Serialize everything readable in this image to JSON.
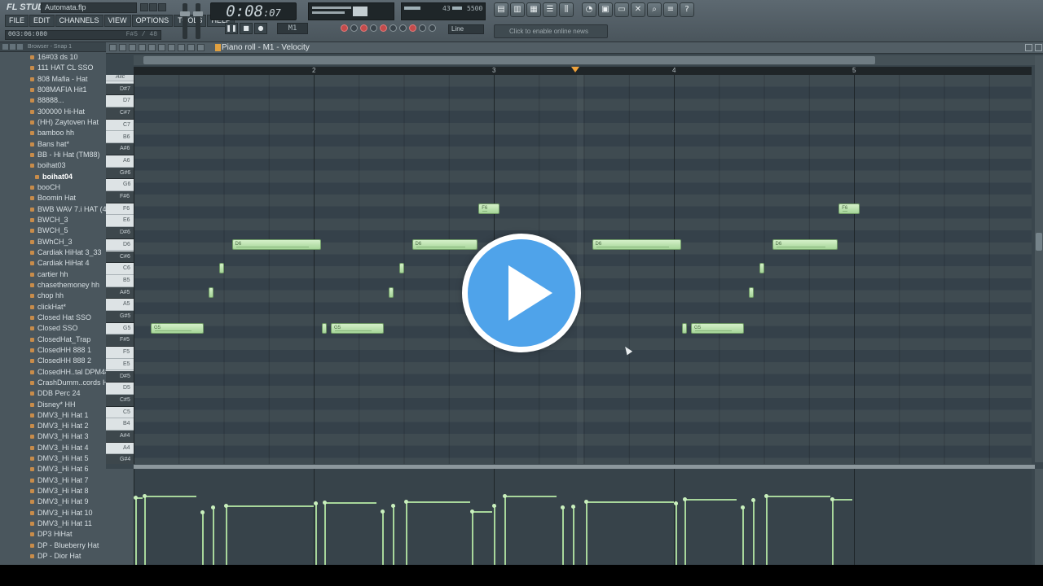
{
  "app": {
    "logo": "FL STUDIO",
    "file_name": "Automata.flp",
    "menu": [
      "FILE",
      "EDIT",
      "CHANNELS",
      "VIEW",
      "OPTIONS",
      "TOOLS",
      "HELP"
    ],
    "status_text": "003:06:080",
    "status_right": "F#5 / 48"
  },
  "transport": {
    "time_main": "0:08",
    "time_frac": ":07",
    "pattern": "M1",
    "cpu_value": "43",
    "memory_value": "5500",
    "line_mode": "Line",
    "news_hint": "Click to enable online news"
  },
  "browser": {
    "header": "Browser - Snap 1",
    "items": [
      "16#03 ds 10",
      "111 HAT CL SSO",
      "808 Mafia - Hat",
      "808MAFIA Hit1",
      "88888...",
      "300000 Hi-Hat",
      "(HH) Zaytoven Hat",
      "bamboo hh",
      "Bans hat*",
      "BB - Hi Hat (TM88)",
      "boihat03",
      "boihat04",
      "booCH",
      "Boomin Hat",
      "BWB WAV 7.i HAT (48)",
      "BWCH_3",
      "BWCH_5",
      "BWhCH_3",
      "Cardiak HiHat 3_33",
      "Cardiak HiHat 4",
      "cartier hh",
      "chasethemoney hh",
      "chop hh",
      "clickHat*",
      "Closed Hat SSO",
      "Closed SSO",
      "ClosedHat_Trap",
      "ClosedHH 888 1",
      "ClosedHH 888 2",
      "ClosedHH..tal DPM48",
      "CrashDumm..cords Hat",
      "DDB Perc 24",
      "Disney* HH",
      "DMV3_Hi Hat 1",
      "DMV3_Hi Hat 2",
      "DMV3_Hi Hat 3",
      "DMV3_Hi Hat 4",
      "DMV3_Hi Hat 5",
      "DMV3_Hi Hat 6",
      "DMV3_Hi Hat 7",
      "DMV3_Hi Hat 8",
      "DMV3_Hi Hat 9",
      "DMV3_Hi Hat 10",
      "DMV3_Hi Hat 11",
      "DP3 HiHat",
      "DP - Blueberry Hat",
      "DP - Dior Hat"
    ],
    "selected_index": 11
  },
  "piano_roll": {
    "title": "Piano roll - M1 - Velocity",
    "bars": [
      "2",
      "3",
      "4",
      "5"
    ],
    "keys_top_label": "Alic",
    "keys": [
      "C7",
      "D#7",
      "D7",
      "C#7",
      "C7",
      "B6",
      "A#6",
      "A6",
      "G#6",
      "G6",
      "F#6",
      "F6",
      "E6",
      "D#6",
      "D6",
      "C#6",
      "C6",
      "B5",
      "A#5",
      "A5",
      "G#5",
      "G5",
      "F#5",
      "F5",
      "E5",
      "D#5",
      "D5",
      "C#5",
      "C5",
      "B4",
      "A#4",
      "A4",
      "G#4"
    ],
    "notes": [
      {
        "pitch": "G5",
        "start": 0.05,
        "length": 0.3,
        "label": "G5"
      },
      {
        "pitch": "A#5",
        "start": 0.37,
        "length": 0.02,
        "label": ""
      },
      {
        "pitch": "C6",
        "start": 0.43,
        "length": 0.02,
        "label": ""
      },
      {
        "pitch": "D6",
        "start": 0.5,
        "length": 0.5,
        "label": "D6"
      },
      {
        "pitch": "G5",
        "start": 1.0,
        "length": 0.02,
        "label": ""
      },
      {
        "pitch": "G5",
        "start": 1.05,
        "length": 0.3,
        "label": "G5"
      },
      {
        "pitch": "A#5",
        "start": 1.37,
        "length": 0.02,
        "label": ""
      },
      {
        "pitch": "C6",
        "start": 1.43,
        "length": 0.02,
        "label": ""
      },
      {
        "pitch": "D6",
        "start": 1.5,
        "length": 0.37,
        "label": "D6"
      },
      {
        "pitch": "F6",
        "start": 1.87,
        "length": 0.12,
        "label": "F6"
      },
      {
        "pitch": "D6",
        "start": 2.5,
        "length": 0.5,
        "label": "D6"
      },
      {
        "pitch": "G5",
        "start": 3.0,
        "length": 0.02,
        "label": ""
      },
      {
        "pitch": "G5",
        "start": 3.05,
        "length": 0.3,
        "label": "G5"
      },
      {
        "pitch": "A#5",
        "start": 3.37,
        "length": 0.02,
        "label": ""
      },
      {
        "pitch": "C6",
        "start": 3.43,
        "length": 0.02,
        "label": ""
      },
      {
        "pitch": "D6",
        "start": 3.5,
        "length": 0.37,
        "label": "D6"
      },
      {
        "pitch": "F6",
        "start": 3.87,
        "length": 0.12,
        "label": "F6"
      }
    ],
    "velocity": [
      {
        "start": 0.0,
        "length": 0.05,
        "level": 0.7
      },
      {
        "start": 0.05,
        "length": 0.3,
        "level": 0.72
      },
      {
        "start": 0.37,
        "length": 0.02,
        "level": 0.55
      },
      {
        "start": 0.43,
        "length": 0.02,
        "level": 0.6
      },
      {
        "start": 0.5,
        "length": 0.5,
        "level": 0.62
      },
      {
        "start": 1.0,
        "length": 0.02,
        "level": 0.64
      },
      {
        "start": 1.05,
        "length": 0.3,
        "level": 0.65
      },
      {
        "start": 1.37,
        "length": 0.02,
        "level": 0.56
      },
      {
        "start": 1.43,
        "length": 0.02,
        "level": 0.62
      },
      {
        "start": 1.5,
        "length": 0.37,
        "level": 0.66
      },
      {
        "start": 1.87,
        "length": 0.12,
        "level": 0.56
      },
      {
        "start": 1.99,
        "length": 0.02,
        "level": 0.62
      },
      {
        "start": 2.05,
        "length": 0.3,
        "level": 0.72
      },
      {
        "start": 2.37,
        "length": 0.02,
        "level": 0.6
      },
      {
        "start": 2.43,
        "length": 0.02,
        "level": 0.61
      },
      {
        "start": 2.5,
        "length": 0.5,
        "level": 0.66
      },
      {
        "start": 3.0,
        "length": 0.02,
        "level": 0.64
      },
      {
        "start": 3.05,
        "length": 0.3,
        "level": 0.69
      },
      {
        "start": 3.37,
        "length": 0.02,
        "level": 0.6
      },
      {
        "start": 3.43,
        "length": 0.02,
        "level": 0.68
      },
      {
        "start": 3.5,
        "length": 0.37,
        "level": 0.72
      },
      {
        "start": 3.87,
        "length": 0.12,
        "level": 0.69
      }
    ]
  },
  "overlay": {
    "play_icon": "play-icon"
  }
}
